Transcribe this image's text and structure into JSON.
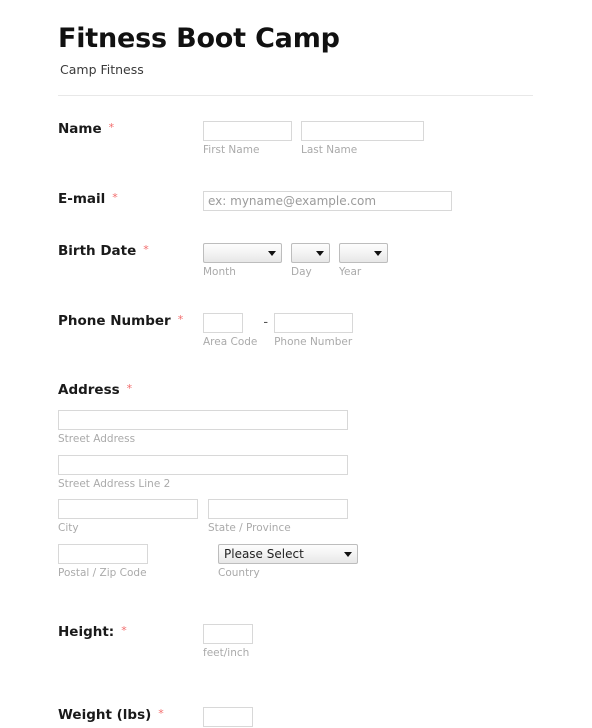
{
  "header": {
    "title": "Fitness Boot Camp",
    "subtitle": "Camp Fitness"
  },
  "required_marker": "*",
  "accent_color": "#f26c6c",
  "fields": {
    "name": {
      "label": "Name",
      "first": {
        "value": "",
        "sub": "First Name"
      },
      "last": {
        "value": "",
        "sub": "Last Name"
      }
    },
    "email": {
      "label": "E-mail",
      "placeholder": "ex: myname@example.com",
      "value": ""
    },
    "birth_date": {
      "label": "Birth Date",
      "month": {
        "selected": "",
        "sub": "Month"
      },
      "day": {
        "selected": "",
        "sub": "Day"
      },
      "year": {
        "selected": "",
        "sub": "Year"
      }
    },
    "phone": {
      "label": "Phone Number",
      "separator": "-",
      "area_code": {
        "value": "",
        "sub": "Area Code"
      },
      "number": {
        "value": "",
        "sub": "Phone Number"
      }
    },
    "address": {
      "label": "Address",
      "street": {
        "value": "",
        "sub": "Street Address"
      },
      "street2": {
        "value": "",
        "sub": "Street Address Line 2"
      },
      "city": {
        "value": "",
        "sub": "City"
      },
      "state": {
        "value": "",
        "sub": "State / Province"
      },
      "zip": {
        "value": "",
        "sub": "Postal / Zip Code"
      },
      "country": {
        "selected": "Please Select",
        "sub": "Country"
      }
    },
    "height": {
      "label": "Height:",
      "value": "",
      "sub": "feet/inch"
    },
    "weight": {
      "label": "Weight (lbs)",
      "value": ""
    }
  }
}
